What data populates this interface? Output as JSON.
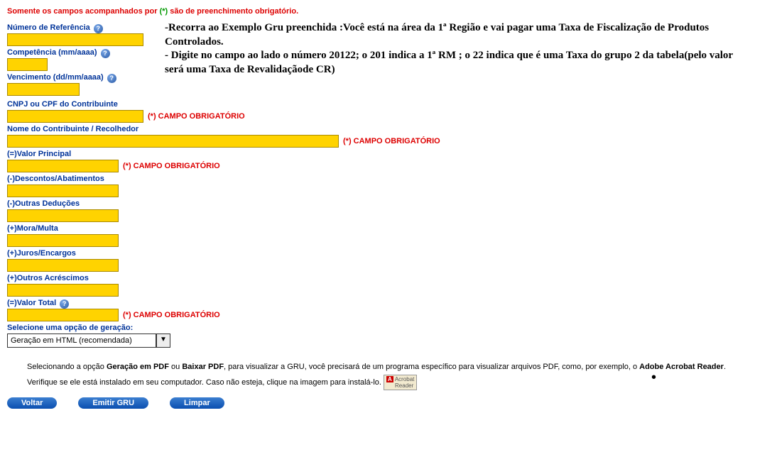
{
  "warning": {
    "prefix": "Somente os campos acompanhados por ",
    "asterisk": "(*)",
    "suffix": " são de preenchimento obrigatório."
  },
  "info": {
    "line1": "-Recorra ao Exemplo Gru preenchida :Você está na área da 1ª Região e vai pagar uma Taxa de Fiscalização de Produtos Controlados.",
    "line2": "- Digite no campo ao lado o número 20122; o 201 indica a 1ª RM ; o 22 indica que é uma Taxa do grupo 2 da tabela(pelo valor será uma Taxa de Revalidaçãode CR)"
  },
  "labels": {
    "num_ref": "Número de Referência",
    "competencia": "Competência (mm/aaaa)",
    "vencimento": "Vencimento (dd/mm/aaaa)",
    "cnpj": "CNPJ ou CPF do Contribuinte",
    "nome": "Nome do Contribuinte / Recolhedor",
    "valor_principal": "(=)Valor Principal",
    "descontos": "(-)Descontos/Abatimentos",
    "outras_deducoes": "(-)Outras Deduções",
    "mora": "(+)Mora/Multa",
    "juros": "(+)Juros/Encargos",
    "outros_acrescimos": "(+)Outros Acréscimos",
    "valor_total": "(=)Valor Total",
    "selecione": "Selecione uma opção de geração:"
  },
  "required_text": "(*) CAMPO OBRIGATÓRIO",
  "select": {
    "selected": "Geração em HTML (recomendada)"
  },
  "footer": {
    "p1_a": "Selecionando a opção ",
    "p1_b": "Geração em PDF",
    "p1_c": " ou ",
    "p1_d": "Baixar PDF",
    "p1_e": ", para visualizar a GRU, você precisará de um programa específico para visualizar arquivos PDF, como, por exemplo, o ",
    "p1_f": "Adobe Acrobat Reader",
    "p1_g": ".",
    "p2": "Verifique se ele está instalado em seu computador. Caso não esteja, clique na imagem para instalá-lo."
  },
  "buttons": {
    "voltar": "Voltar",
    "emitir": "Emitir GRU",
    "limpar": "Limpar"
  },
  "help_glyph": "?"
}
